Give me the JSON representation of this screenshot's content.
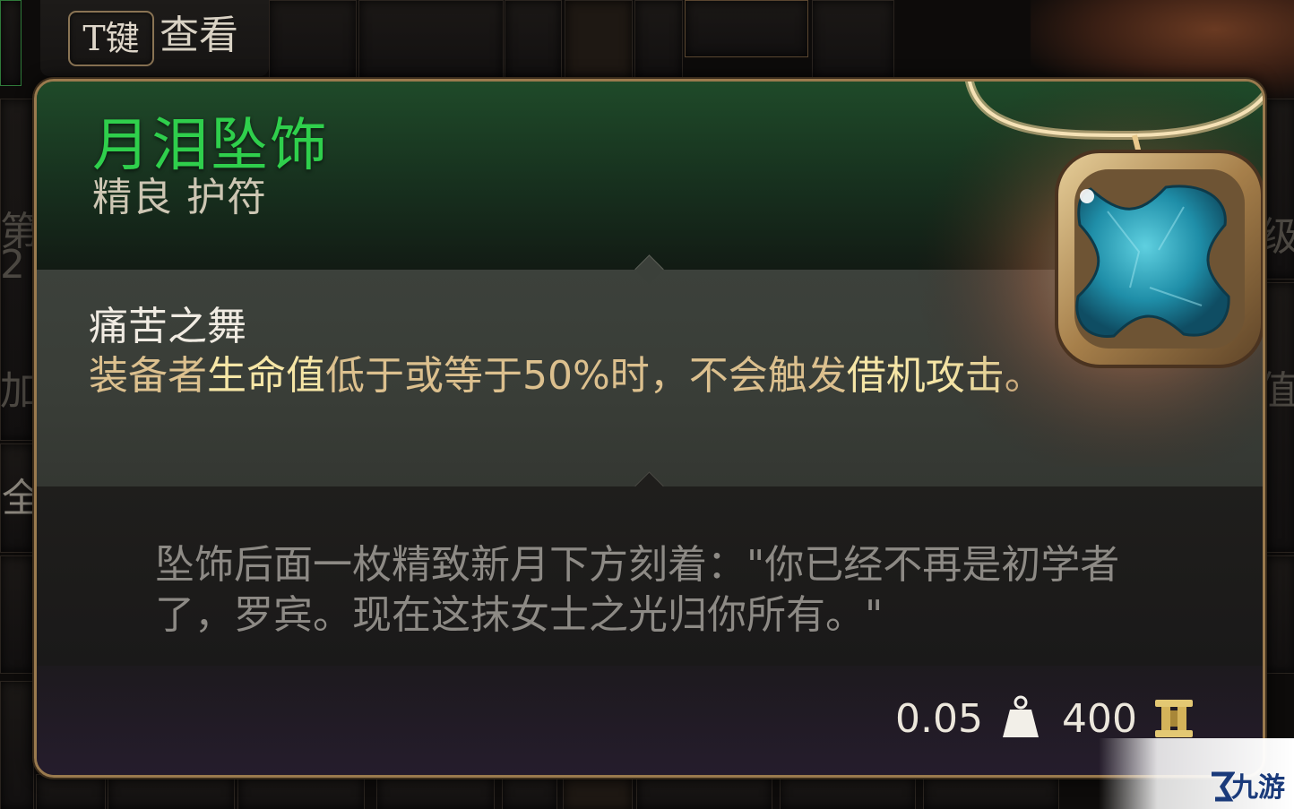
{
  "hint": {
    "key": "T键",
    "label": "查看"
  },
  "item": {
    "name": "月泪坠饰",
    "type": "精良 护符",
    "ability": {
      "name": "痛苦之舞",
      "desc_parts": [
        {
          "text": "装备者",
          "kw": false
        },
        {
          "text": "生命值",
          "kw": true
        },
        {
          "text": "低于或等于50%时，不会触发",
          "kw": false
        },
        {
          "text": "借机攻击",
          "kw": true
        },
        {
          "text": "。",
          "kw": false
        }
      ]
    },
    "lore": "坠饰后面一枚精致新月下方刻着：\"你已经不再是初学者了，罗宾。现在这抹女士之光归你所有。\"",
    "weight": "0.05",
    "price": "400",
    "icons": {
      "weight": "weight-icon",
      "price": "gold-coin-icon",
      "art": "amulet-icon"
    }
  },
  "colors": {
    "item_name": "#2fcf4c",
    "keyword": "#f6e6a6",
    "description": "#dcc08e",
    "border": "#9a7a4e"
  },
  "watermark": {
    "text": "九游"
  }
}
